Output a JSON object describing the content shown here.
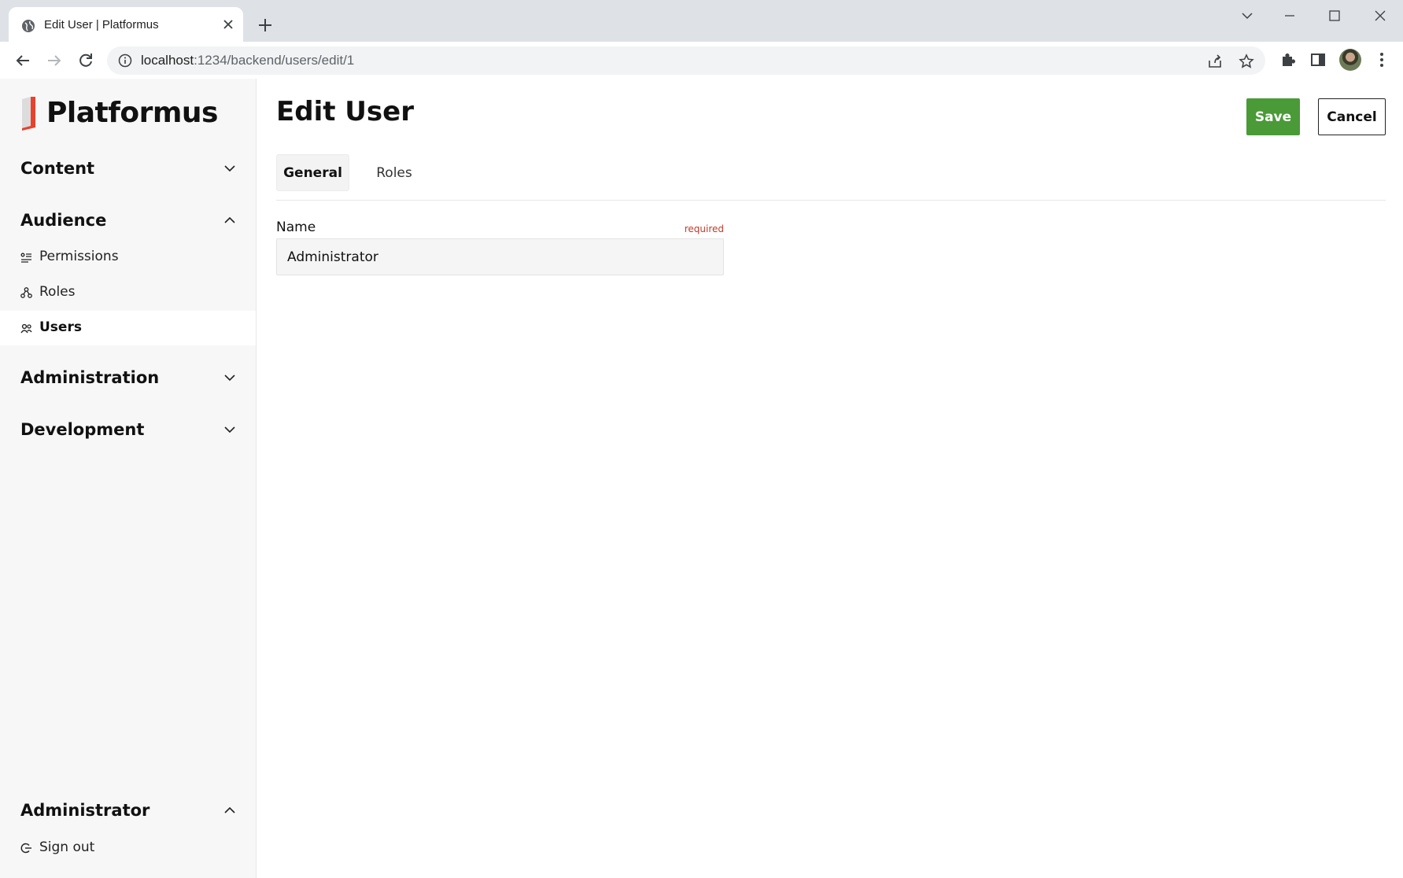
{
  "browser": {
    "tab_title": "Edit User | Platformus",
    "url_host": "localhost",
    "url_path": ":1234/backend/users/edit/1"
  },
  "sidebar": {
    "brand": "Platformus",
    "brand_accent_color": "#e8412c",
    "groups": [
      {
        "label": "Content",
        "expanded": false
      },
      {
        "label": "Audience",
        "expanded": true,
        "items": [
          {
            "label": "Permissions",
            "icon": "permissions-icon"
          },
          {
            "label": "Roles",
            "icon": "roles-icon"
          },
          {
            "label": "Users",
            "icon": "users-icon",
            "active": true
          }
        ]
      },
      {
        "label": "Administration",
        "expanded": false
      },
      {
        "label": "Development",
        "expanded": false
      }
    ],
    "account": {
      "label": "Administrator",
      "expanded": true,
      "items": [
        {
          "label": "Sign out",
          "icon": "sign-out-icon"
        }
      ]
    }
  },
  "main": {
    "title": "Edit User",
    "save_label": "Save",
    "save_color": "#4a9a38",
    "cancel_label": "Cancel",
    "tabs": [
      {
        "label": "General",
        "active": true
      },
      {
        "label": "Roles",
        "active": false
      }
    ],
    "form": {
      "name_label": "Name",
      "name_required": "required",
      "name_value": "Administrator"
    }
  }
}
